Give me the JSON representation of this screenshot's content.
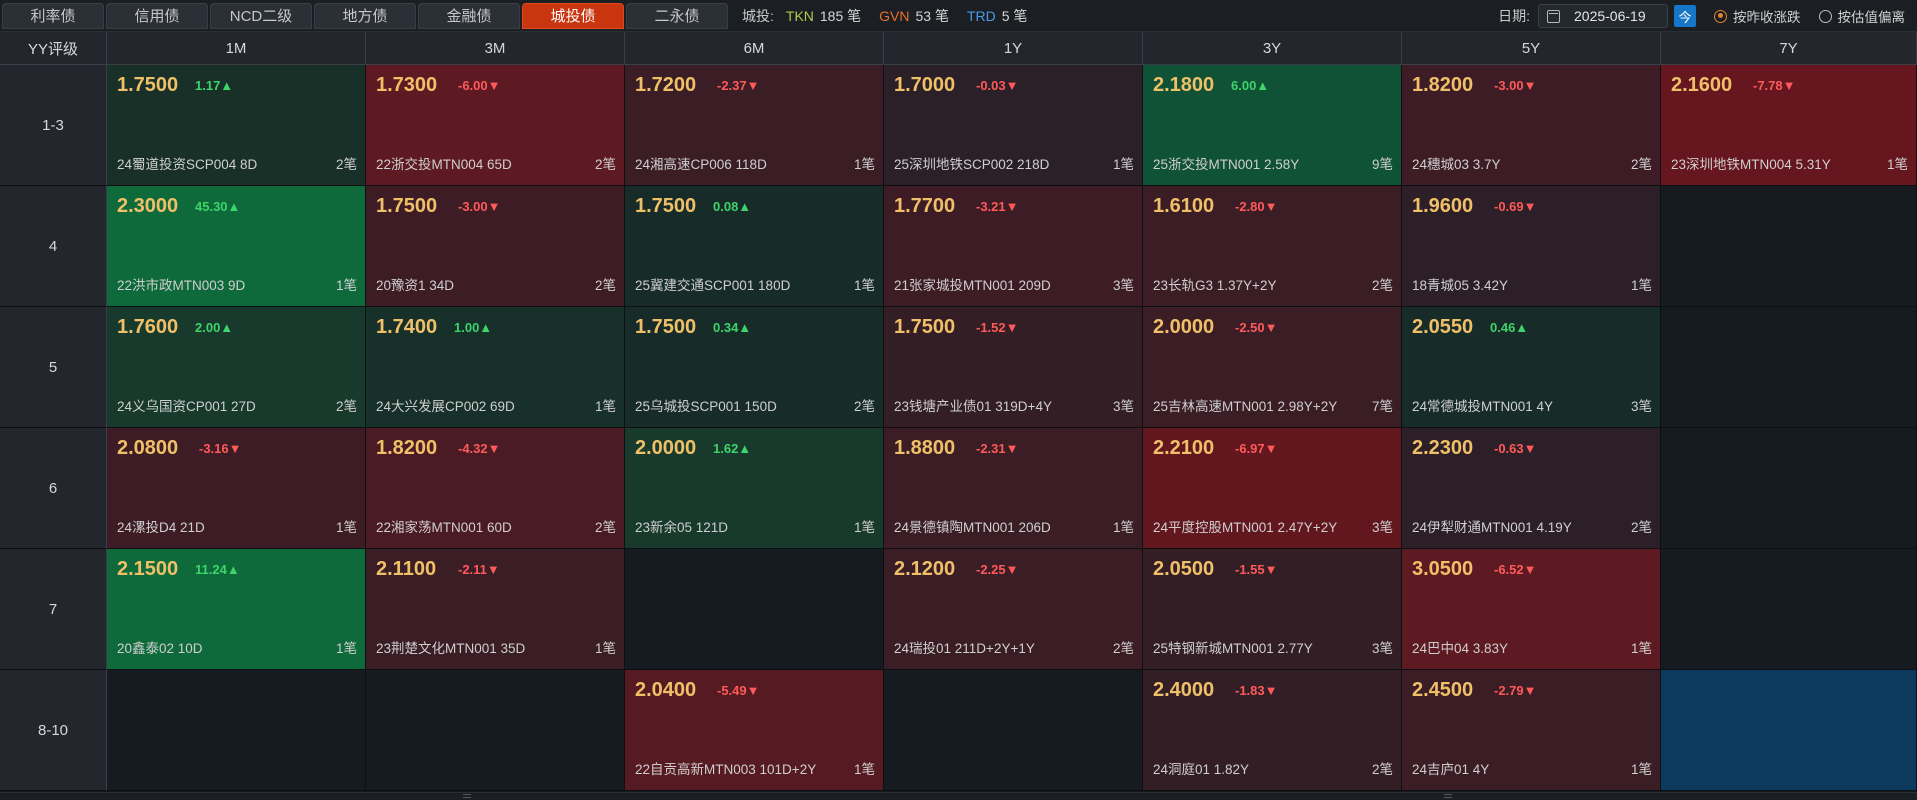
{
  "tabs": [
    {
      "label": "利率债",
      "active": false
    },
    {
      "label": "信用债",
      "active": false
    },
    {
      "label": "NCD二级",
      "active": false
    },
    {
      "label": "地方债",
      "active": false
    },
    {
      "label": "金融债",
      "active": false
    },
    {
      "label": "城投债",
      "active": true
    },
    {
      "label": "二永债",
      "active": false
    }
  ],
  "stats": {
    "label": "城投:",
    "tkn_code": "TKN",
    "tkn_count": "185 笔",
    "gvn_code": "GVN",
    "gvn_count": "53 笔",
    "trd_code": "TRD",
    "trd_count": "5 笔"
  },
  "toolbar": {
    "date_label": "日期:",
    "date_value": "2025-06-19",
    "today_label": "今",
    "radio_prev_close": "按昨收涨跌",
    "radio_valuation": "按估值偏离"
  },
  "colors": {
    "active_tab": "#c9350f",
    "up": "#3ed46a",
    "down": "#ff5a5a",
    "price": "#f0c068",
    "tkn": "#b8c84a",
    "gvn": "#e8702a",
    "trd": "#4a9ae8"
  },
  "grid": {
    "corner": "YY评级",
    "columns": [
      "1M",
      "3M",
      "6M",
      "1Y",
      "3Y",
      "5Y",
      "7Y"
    ],
    "rows": [
      {
        "rating": "1-3",
        "cells": [
          {
            "price": "1.7500",
            "chg": "1.17▲",
            "dir": "up",
            "bond": "24蜀道投资SCP004 8D",
            "count": "2笔",
            "bg": "#183028"
          },
          {
            "price": "1.7300",
            "chg": "-6.00▼",
            "dir": "down",
            "bond": "22浙交投MTN004 65D",
            "count": "2笔",
            "bg": "#5e1a22"
          },
          {
            "price": "1.7200",
            "chg": "-2.37▼",
            "dir": "down",
            "bond": "24湘高速CP006 118D",
            "count": "1笔",
            "bg": "#3b1d25"
          },
          {
            "price": "1.7000",
            "chg": "-0.03▼",
            "dir": "down",
            "bond": "25深圳地铁SCP002 218D",
            "count": "1笔",
            "bg": "#2b2028"
          },
          {
            "price": "2.1800",
            "chg": "6.00▲",
            "dir": "up",
            "bond": "25浙交投MTN001 2.58Y",
            "count": "9笔",
            "bg": "#0f5236"
          },
          {
            "price": "1.8200",
            "chg": "-3.00▼",
            "dir": "down",
            "bond": "24穗城03 3.7Y",
            "count": "2笔",
            "bg": "#3d1c25"
          },
          {
            "price": "2.1600",
            "chg": "-7.78▼",
            "dir": "down",
            "bond": "23深圳地铁MTN004 5.31Y",
            "count": "1笔",
            "bg": "#66161f"
          }
        ]
      },
      {
        "rating": "4",
        "cells": [
          {
            "price": "2.3000",
            "chg": "45.30▲",
            "dir": "up",
            "bond": "22洪市政MTN003 9D",
            "count": "1笔",
            "bg": "#0e6a3a"
          },
          {
            "price": "1.7500",
            "chg": "-3.00▼",
            "dir": "down",
            "bond": "20豫资1 34D",
            "count": "2笔",
            "bg": "#3d1c25"
          },
          {
            "price": "1.7500",
            "chg": "0.08▲",
            "dir": "up",
            "bond": "25冀建交通SCP001 180D",
            "count": "1笔",
            "bg": "#172c29"
          },
          {
            "price": "1.7700",
            "chg": "-3.21▼",
            "dir": "down",
            "bond": "21张家城投MTN001 209D",
            "count": "3笔",
            "bg": "#3d1c25"
          },
          {
            "price": "1.6100",
            "chg": "-2.80▼",
            "dir": "down",
            "bond": "23长轨G3 1.37Y+2Y",
            "count": "2笔",
            "bg": "#3b1d25"
          },
          {
            "price": "1.9600",
            "chg": "-0.69▼",
            "dir": "down",
            "bond": "18青城05 3.42Y",
            "count": "1笔",
            "bg": "#2c1f28"
          },
          null
        ]
      },
      {
        "rating": "5",
        "cells": [
          {
            "price": "1.7600",
            "chg": "2.00▲",
            "dir": "up",
            "bond": "24义乌国资CP001 27D",
            "count": "2笔",
            "bg": "#183a2c"
          },
          {
            "price": "1.7400",
            "chg": "1.00▲",
            "dir": "up",
            "bond": "24大兴发展CP002 69D",
            "count": "1笔",
            "bg": "#17302a"
          },
          {
            "price": "1.7500",
            "chg": "0.34▲",
            "dir": "up",
            "bond": "25乌城投SCP001 150D",
            "count": "2笔",
            "bg": "#172c29"
          },
          {
            "price": "1.7500",
            "chg": "-1.52▼",
            "dir": "down",
            "bond": "23钱塘产业债01 319D+4Y",
            "count": "3笔",
            "bg": "#331e26"
          },
          {
            "price": "2.0000",
            "chg": "-2.50▼",
            "dir": "down",
            "bond": "25吉林高速MTN001 2.98Y+2Y",
            "count": "7笔",
            "bg": "#3a1d25"
          },
          {
            "price": "2.0550",
            "chg": "0.46▲",
            "dir": "up",
            "bond": "24常德城投MTN001 4Y",
            "count": "3笔",
            "bg": "#172c29"
          },
          null
        ]
      },
      {
        "rating": "6",
        "cells": [
          {
            "price": "2.0800",
            "chg": "-3.16▼",
            "dir": "down",
            "bond": "24漯投D4 21D",
            "count": "1笔",
            "bg": "#3d1c25"
          },
          {
            "price": "1.8200",
            "chg": "-4.32▼",
            "dir": "down",
            "bond": "22湘家荡MTN001 60D",
            "count": "2笔",
            "bg": "#4a1b24"
          },
          {
            "price": "2.0000",
            "chg": "1.62▲",
            "dir": "up",
            "bond": "23新余05 121D",
            "count": "1笔",
            "bg": "#183a2c"
          },
          {
            "price": "1.8800",
            "chg": "-2.31▼",
            "dir": "down",
            "bond": "24景德镇陶MTN001 206D",
            "count": "1笔",
            "bg": "#3a1d25"
          },
          {
            "price": "2.2100",
            "chg": "-6.97▼",
            "dir": "down",
            "bond": "24平度控股MTN001 2.47Y+2Y",
            "count": "3笔",
            "bg": "#62171f"
          },
          {
            "price": "2.2300",
            "chg": "-0.63▼",
            "dir": "down",
            "bond": "24伊犁财通MTN001 4.19Y",
            "count": "2笔",
            "bg": "#2c1f28"
          },
          null
        ]
      },
      {
        "rating": "7",
        "cells": [
          {
            "price": "2.1500",
            "chg": "11.24▲",
            "dir": "up",
            "bond": "20鑫泰02 10D",
            "count": "1笔",
            "bg": "#0e6a3a"
          },
          {
            "price": "2.1100",
            "chg": "-2.11▼",
            "dir": "down",
            "bond": "23荆楚文化MTN001 35D",
            "count": "1笔",
            "bg": "#3a1d25"
          },
          null,
          {
            "price": "2.1200",
            "chg": "-2.25▼",
            "dir": "down",
            "bond": "24瑞投01 211D+2Y+1Y",
            "count": "2笔",
            "bg": "#3a1d25"
          },
          {
            "price": "2.0500",
            "chg": "-1.55▼",
            "dir": "down",
            "bond": "25特钢新城MTN001 2.77Y",
            "count": "3笔",
            "bg": "#331e26"
          },
          {
            "price": "3.0500",
            "chg": "-6.52▼",
            "dir": "down",
            "bond": "24巴中04 3.83Y",
            "count": "1笔",
            "bg": "#5e1a22"
          },
          null
        ]
      },
      {
        "rating": "8-10",
        "cells": [
          null,
          null,
          {
            "price": "2.0400",
            "chg": "-5.49▼",
            "dir": "down",
            "bond": "22自贡高新MTN003 101D+2Y",
            "count": "1笔",
            "bg": "#561a22"
          },
          null,
          {
            "price": "2.4000",
            "chg": "-1.83▼",
            "dir": "down",
            "bond": "24洞庭01 1.82Y",
            "count": "2笔",
            "bg": "#331e26"
          },
          {
            "price": "2.4500",
            "chg": "-2.79▼",
            "dir": "down",
            "bond": "24吉庐01 4Y",
            "count": "1笔",
            "bg": "#3a1d25"
          },
          {
            "price": null,
            "chg": null,
            "dir": null,
            "bond": null,
            "count": null,
            "bg": "#0c3a5e"
          }
        ]
      }
    ]
  }
}
